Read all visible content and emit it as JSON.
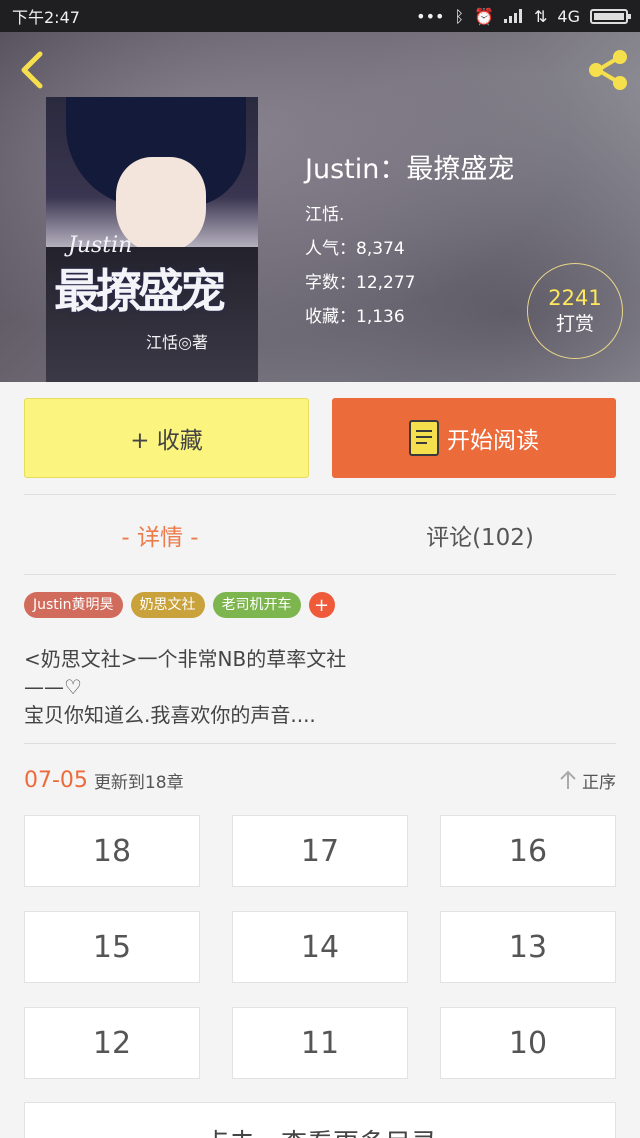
{
  "status_bar": {
    "time": "下午2:47",
    "network": "4G"
  },
  "header": {
    "back_icon": "chevron-left-icon",
    "share_icon": "share-icon"
  },
  "book": {
    "title": "Justin：最撩盛宠",
    "author": "江恬.",
    "popularity_label": "人气：",
    "popularity": "8,374",
    "words_label": "字数：",
    "words": "12,277",
    "favorites_label": "收藏：",
    "favorites": "1,136",
    "cover": {
      "title_en": "Justin",
      "title_cn": "最撩盛宠",
      "author": "江恬◎著"
    }
  },
  "reward": {
    "count": "2241",
    "label": "打赏"
  },
  "actions": {
    "collect_label": "+ 收藏",
    "read_label": "开始阅读"
  },
  "tabs": [
    {
      "label": "- 详情 -",
      "active": true
    },
    {
      "label": "评论(102)",
      "active": false
    }
  ],
  "tags": [
    {
      "label": "Justin黄明昊",
      "color": "#d16b5b"
    },
    {
      "label": "奶思文社",
      "color": "#c9a23b"
    },
    {
      "label": "老司机开车",
      "color": "#7db54e"
    }
  ],
  "tag_add_label": "+",
  "description": {
    "line1": "<奶思文社>一个非常NB的草率文社",
    "line2": "——♡",
    "line3": "宝贝你知道么.我喜欢你的声音...."
  },
  "update": {
    "date": "07-05",
    "text": "更新到18章",
    "sort_label": "正序"
  },
  "chapters": [
    "18",
    "17",
    "16",
    "15",
    "14",
    "13",
    "12",
    "11",
    "10"
  ],
  "more_label": "点击，查看更多目录",
  "colors": {
    "accent": "#ec6b3b",
    "collect_bg": "#fbf47e",
    "reward_yellow": "#ffe85c"
  }
}
